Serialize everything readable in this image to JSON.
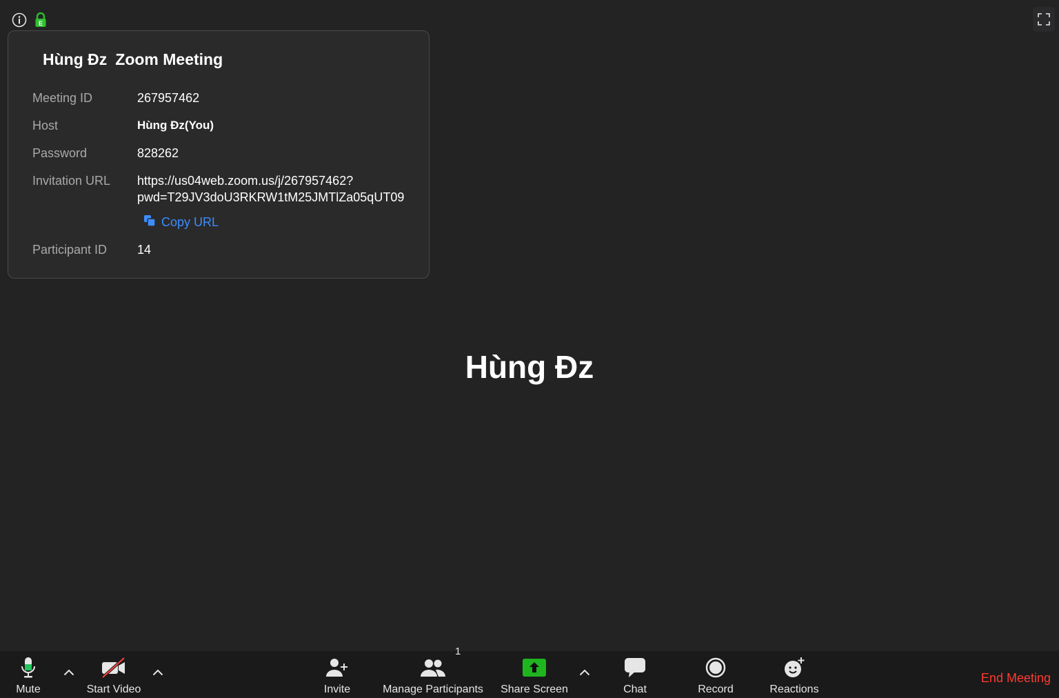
{
  "meeting": {
    "popup_host_name": "Hùng Đz",
    "popup_app_name": "Zoom Meeting",
    "rows": [
      {
        "label": "Meeting ID",
        "value": "267957462"
      },
      {
        "label": "Host",
        "value": "Hùng Đz(You)"
      },
      {
        "label": "Password",
        "value": "828262"
      },
      {
        "label": "Invitation URL",
        "value_line1": "https://us04web.zoom.us/j/267957462?",
        "value_line2": "pwd=T29JV3doU3RKRW1tM25JMTlZa05qUT09"
      },
      {
        "label": "Participant ID",
        "value": "14"
      }
    ],
    "copy_url_label": "Copy URL",
    "center_name": "Hùng Đz"
  },
  "toolbar": {
    "mute": "Mute",
    "start_video": "Start Video",
    "invite": "Invite",
    "manage_participants": "Manage Participants",
    "participant_count": "1",
    "share_screen": "Share Screen",
    "chat": "Chat",
    "record": "Record",
    "reactions": "Reactions",
    "end_meeting": "End Meeting"
  },
  "colors": {
    "background": "#232323",
    "toolbar": "#1a1a1a",
    "accent_blue": "#3d8dff",
    "end_red": "#ff3b30",
    "mic_green": "#22c55e",
    "share_green": "#1fb51f"
  },
  "icons": [
    "info-icon",
    "lock-icon",
    "fullscreen-icon",
    "copy-icon",
    "microphone-icon",
    "video-off-icon",
    "add-user-icon",
    "participants-icon",
    "share-screen-icon",
    "chat-icon",
    "record-icon",
    "reactions-icon",
    "caret-up-icon"
  ]
}
